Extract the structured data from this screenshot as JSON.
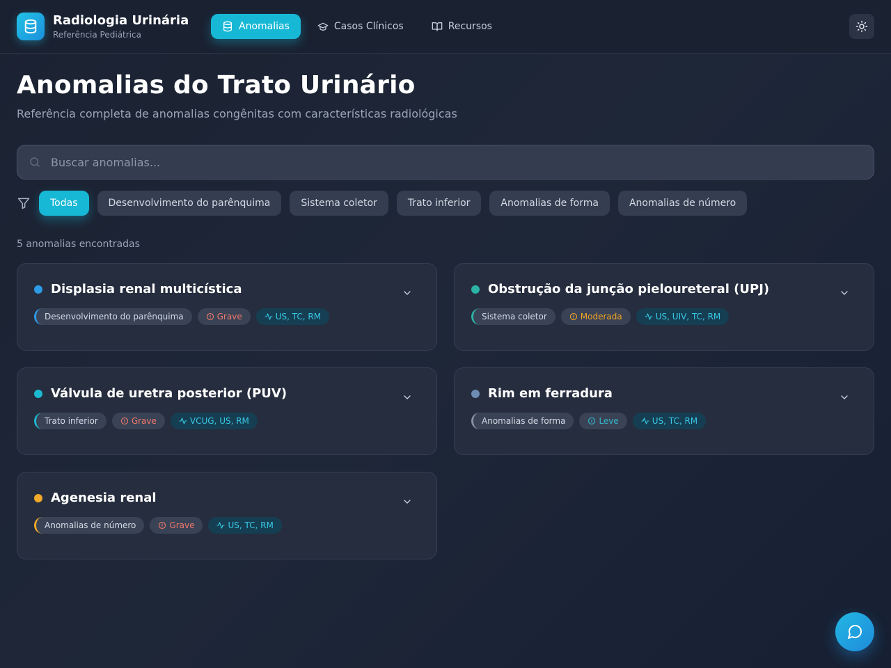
{
  "app": {
    "title": "Radiologia Urinária",
    "subtitle": "Referência Pediátrica",
    "logo_icon": "database-icon"
  },
  "nav": {
    "items": [
      {
        "label": "Anomalias",
        "icon": "database-icon",
        "active": true
      },
      {
        "label": "Casos Clínicos",
        "icon": "graduation-cap-icon",
        "active": false
      },
      {
        "label": "Recursos",
        "icon": "book-icon",
        "active": false
      }
    ],
    "theme_toggle_icon": "sun-icon"
  },
  "page": {
    "title": "Anomalias do Trato Urinário",
    "subtitle": "Referência completa de anomalias congênitas com características radiológicas"
  },
  "search": {
    "placeholder": "Buscar anomalias...",
    "value": ""
  },
  "filters": {
    "icon": "filter-icon",
    "items": [
      {
        "label": "Todas",
        "active": true
      },
      {
        "label": "Desenvolvimento do parênquima",
        "active": false
      },
      {
        "label": "Sistema coletor",
        "active": false
      },
      {
        "label": "Trato inferior",
        "active": false
      },
      {
        "label": "Anomalias de forma",
        "active": false
      },
      {
        "label": "Anomalias de número",
        "active": false
      }
    ]
  },
  "results": {
    "count_text": "5 anomalias encontradas"
  },
  "cards": [
    {
      "title": "Displasia renal multicística",
      "dot_color": "#2e9be6",
      "category": "Desenvolvimento do parênquima",
      "category_color": "#2e9be6",
      "severity": "Grave",
      "severity_color": "#f0786a",
      "modalities": "US, TC, RM"
    },
    {
      "title": "Obstrução da junção pieloureteral (UPJ)",
      "dot_color": "#2bb3a6",
      "category": "Sistema coletor",
      "category_color": "#2bb3a6",
      "severity": "Moderada",
      "severity_color": "#f5a524",
      "modalities": "US, UIV, TC, RM"
    },
    {
      "title": "Válvula de uretra posterior (PUV)",
      "dot_color": "#1cb9d1",
      "category": "Trato inferior",
      "category_color": "#1cb9d1",
      "severity": "Grave",
      "severity_color": "#f0786a",
      "modalities": "VCUG, US, RM"
    },
    {
      "title": "Rim em ferradura",
      "dot_color": "#6f8cb3",
      "category": "Anomalias de forma",
      "category_color": "#8a93a3",
      "severity": "Leve",
      "severity_color": "#33b6c9",
      "modalities": "US, TC, RM"
    },
    {
      "title": "Agenesia renal",
      "dot_color": "#f0a92a",
      "category": "Anomalias de número",
      "category_color": "#f0a92a",
      "severity": "Grave",
      "severity_color": "#f0786a",
      "modalities": "US, TC, RM"
    }
  ],
  "chat": {
    "icon": "chat-bubble-icon"
  }
}
